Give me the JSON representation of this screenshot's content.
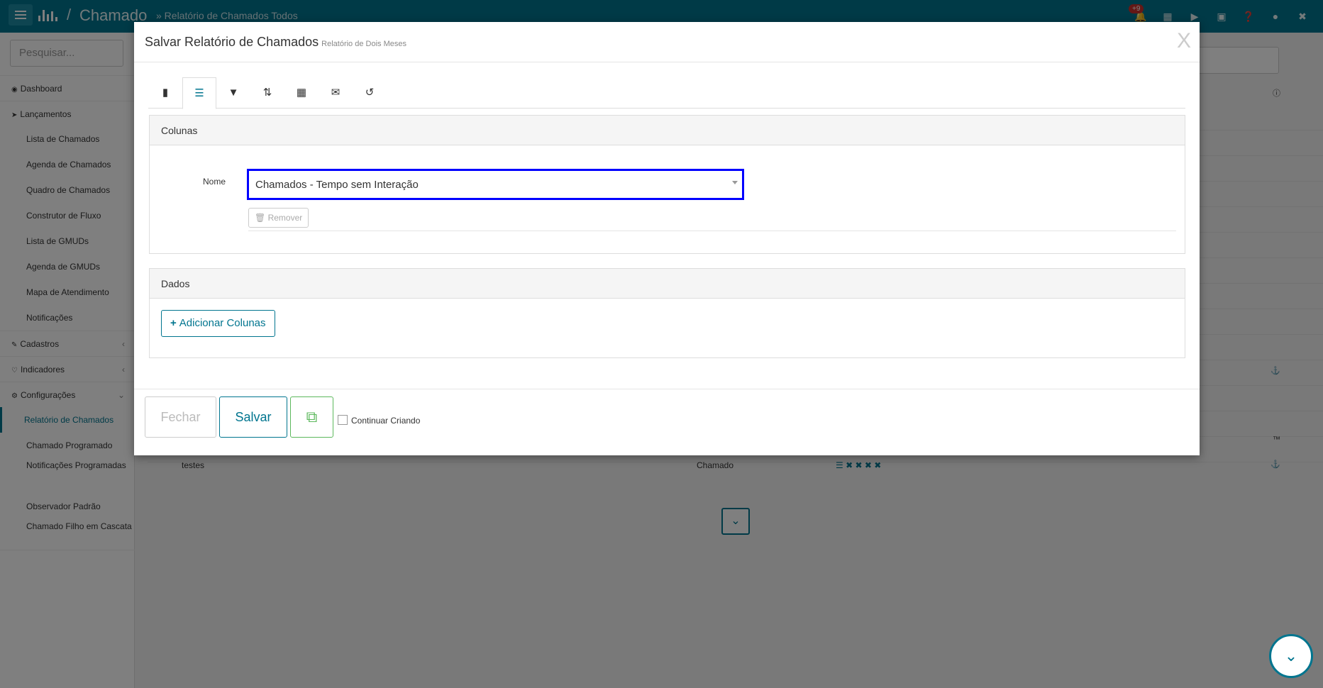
{
  "topbar": {
    "title": "Chamado",
    "separator": "/",
    "breadcrumb": "» Relatório de Chamados Todos",
    "notification_count": "+9"
  },
  "sidebar": {
    "search_placeholder": "Pesquisar...",
    "items": [
      {
        "label": "Dashboard",
        "icon": "dashboard-icon"
      },
      {
        "label": "Lançamentos",
        "icon": "send-icon"
      },
      {
        "label": "Lista de Chamados"
      },
      {
        "label": "Agenda de Chamados"
      },
      {
        "label": "Quadro de Chamados"
      },
      {
        "label": "Construtor de Fluxo"
      },
      {
        "label": "Lista de GMUDs"
      },
      {
        "label": "Agenda de GMUDs"
      },
      {
        "label": "Mapa de Atendimento"
      },
      {
        "label": "Notificações"
      },
      {
        "label": "Cadastros",
        "icon": "edit-icon"
      },
      {
        "label": "Indicadores",
        "icon": "heart-icon"
      },
      {
        "label": "Configurações",
        "icon": "gear-icon"
      },
      {
        "label": "Relatório de Chamados"
      },
      {
        "label": "Chamado Programado"
      },
      {
        "label": "Notificações Programadas"
      },
      {
        "label": "Observador Padrão"
      },
      {
        "label": "Chamado Filho em Cascata"
      }
    ]
  },
  "background": {
    "row_name": "testes",
    "row_type": "Chamado",
    "tm_glyph": "™"
  },
  "modal": {
    "title": "Salvar Relatório de Chamados",
    "subtitle": "Relatório de Dois Meses",
    "close": "X",
    "tabs": [
      "book-icon",
      "list-icon",
      "filter-icon",
      "sort-icon",
      "calendar-icon",
      "envelope-icon",
      "history-icon"
    ],
    "columns_panel": {
      "heading": "Colunas",
      "name_label": "Nome",
      "selected_value": "Chamados - Tempo sem Interação",
      "remove_label": "Remover"
    },
    "data_panel": {
      "heading": "Dados",
      "add_columns_label": "Adicionar Colunas"
    },
    "footer": {
      "close_label": "Fechar",
      "save_label": "Salvar",
      "continue_label": "Continuar Criando"
    }
  },
  "colors": {
    "accent": "#00758f",
    "focus_border": "#0000ff",
    "copy_green": "#5cb85c"
  }
}
